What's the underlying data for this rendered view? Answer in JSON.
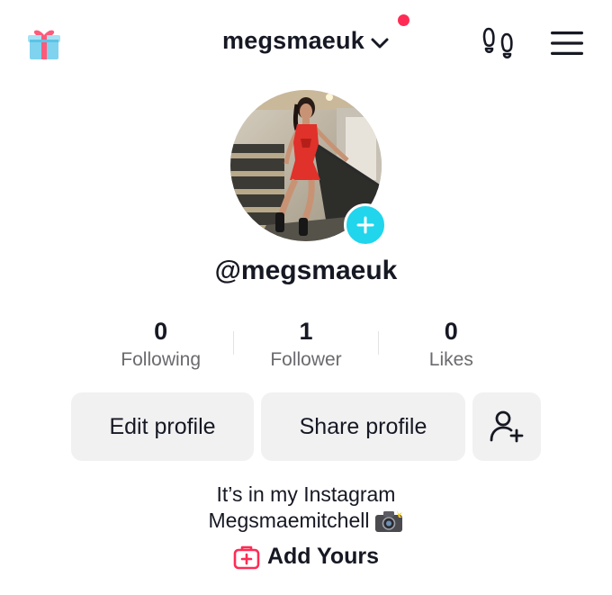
{
  "header": {
    "username": "megsmaeuk",
    "notification_dot_color": "#fe2c55",
    "gift_icon": "gift-icon",
    "footprint_icon": "footprint-icon",
    "menu_icon": "hamburger-menu-icon"
  },
  "profile": {
    "handle": "@megsmaeuk",
    "avatar_add_color": "#20d5ec"
  },
  "stats": [
    {
      "value": "0",
      "label": "Following"
    },
    {
      "value": "1",
      "label": "Follower"
    },
    {
      "value": "0",
      "label": "Likes"
    }
  ],
  "actions": {
    "edit_label": "Edit profile",
    "share_label": "Share profile",
    "add_friend_icon": "add-user-icon"
  },
  "bio": {
    "line1": "It’s in my Instagram",
    "line2": "Megsmaemitchell",
    "emoji": "camera-flash-icon"
  },
  "add_yours": {
    "label": "Add Yours",
    "icon": "add-yours-icon",
    "color": "#fe2c55"
  }
}
